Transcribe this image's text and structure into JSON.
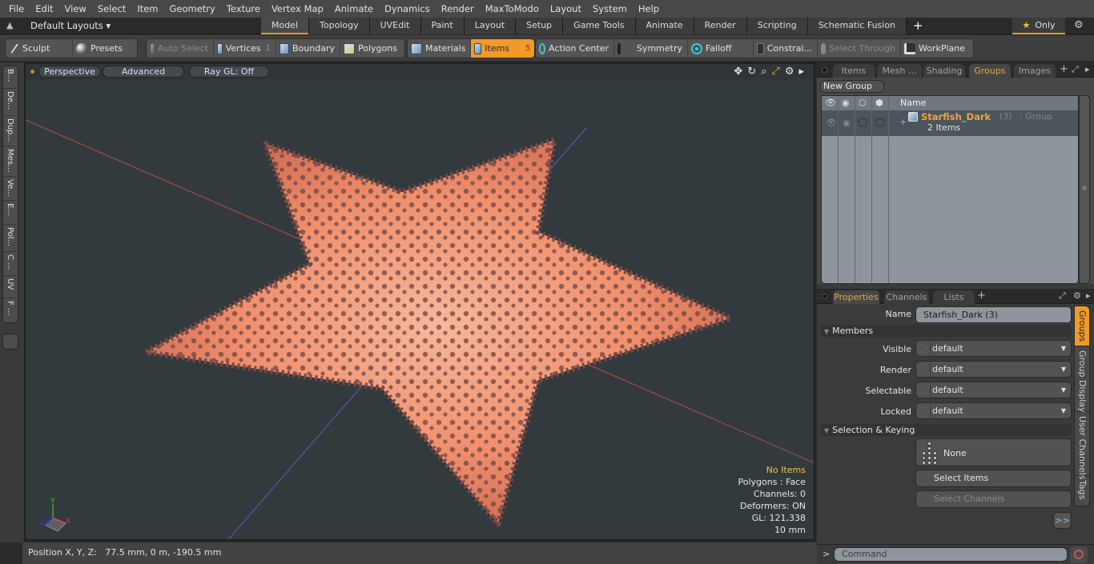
{
  "menubar": {
    "items": [
      "File",
      "Edit",
      "View",
      "Select",
      "Item",
      "Geometry",
      "Texture",
      "Vertex Map",
      "Animate",
      "Dynamics",
      "Render",
      "MaxToModo",
      "Layout",
      "System",
      "Help"
    ]
  },
  "layoutbar": {
    "layout_name": "Default Layouts ▾",
    "tabs": [
      {
        "label": "Model",
        "active": true
      },
      {
        "label": "Topology"
      },
      {
        "label": "UVEdit"
      },
      {
        "label": "Paint"
      },
      {
        "label": "Layout"
      },
      {
        "label": "Setup"
      },
      {
        "label": "Game Tools"
      },
      {
        "label": "Animate"
      },
      {
        "label": "Render"
      },
      {
        "label": "Scripting"
      },
      {
        "label": "Schematic Fusion"
      }
    ],
    "add_tab": "+",
    "only_label": "Only",
    "only_icon": "★"
  },
  "toolbar": {
    "sculpt": "Sculpt",
    "presets": "Presets",
    "auto_select": "Auto Select",
    "vertices": "Vertices",
    "vertices_count": "1",
    "boundary": "Boundary",
    "polygons": "Polygons",
    "materials": "Materials",
    "items": "Items",
    "items_count": "5",
    "action_center": "Action Center",
    "symmetry": "Symmetry",
    "falloff": "Falloff",
    "constraints": "Constrai...",
    "select_through": "Select Through",
    "workplane": "WorkPlane"
  },
  "left_tabs": [
    "B...",
    "De...",
    "Dup...",
    "Mes...",
    "Ve...",
    "E...",
    "Pol...",
    "C ...",
    "UV",
    "F ..."
  ],
  "viewport": {
    "view_mode": "Perspective",
    "shading": "Advanced",
    "raygl": "Ray GL: Off",
    "info": {
      "selection": "No Items",
      "polygons": "Polygons : Face",
      "channels": "Channels: 0",
      "deformers": "Deformers: ON",
      "gl": "GL: 121,338",
      "scale": "10 mm"
    },
    "axis_labels": {
      "x": "X",
      "y": "Y",
      "z": "Z"
    },
    "model": "Starfish"
  },
  "statusbar": {
    "position": "Position X, Y, Z:   77.5 mm, 0 m, -190.5 mm"
  },
  "itemlist_panel": {
    "tabs": [
      {
        "label": "Items"
      },
      {
        "label": "Mesh ..."
      },
      {
        "label": "Shading"
      },
      {
        "label": "Groups",
        "active": true
      },
      {
        "label": "Images"
      }
    ],
    "new_group": "New Group",
    "column_name": "Name",
    "groups": [
      {
        "name": "Starfish_Dark",
        "count": "(3)",
        "type": ": Group",
        "sub": "2 Items"
      }
    ]
  },
  "properties_panel": {
    "tabs": [
      {
        "label": "Properties",
        "active": true
      },
      {
        "label": "Channels"
      },
      {
        "label": "Lists"
      }
    ],
    "name_label": "Name",
    "name_value": "Starfish_Dark (3)",
    "members_section": "Members",
    "fields": [
      {
        "label": "Visible",
        "value": "default"
      },
      {
        "label": "Render",
        "value": "default"
      },
      {
        "label": "Selectable",
        "value": "default"
      },
      {
        "label": "Locked",
        "value": "default"
      }
    ],
    "selection_section": "Selection & Keying",
    "none_label": "None",
    "select_items": "Select Items",
    "select_channels": "Select Channels",
    "more": ">>",
    "side_tabs": [
      {
        "label": "Groups",
        "active": true
      },
      {
        "label": "Group Display"
      },
      {
        "label": "User Channels"
      },
      {
        "label": "Tags"
      }
    ]
  },
  "command": {
    "prompt": ">",
    "placeholder": "Command"
  }
}
